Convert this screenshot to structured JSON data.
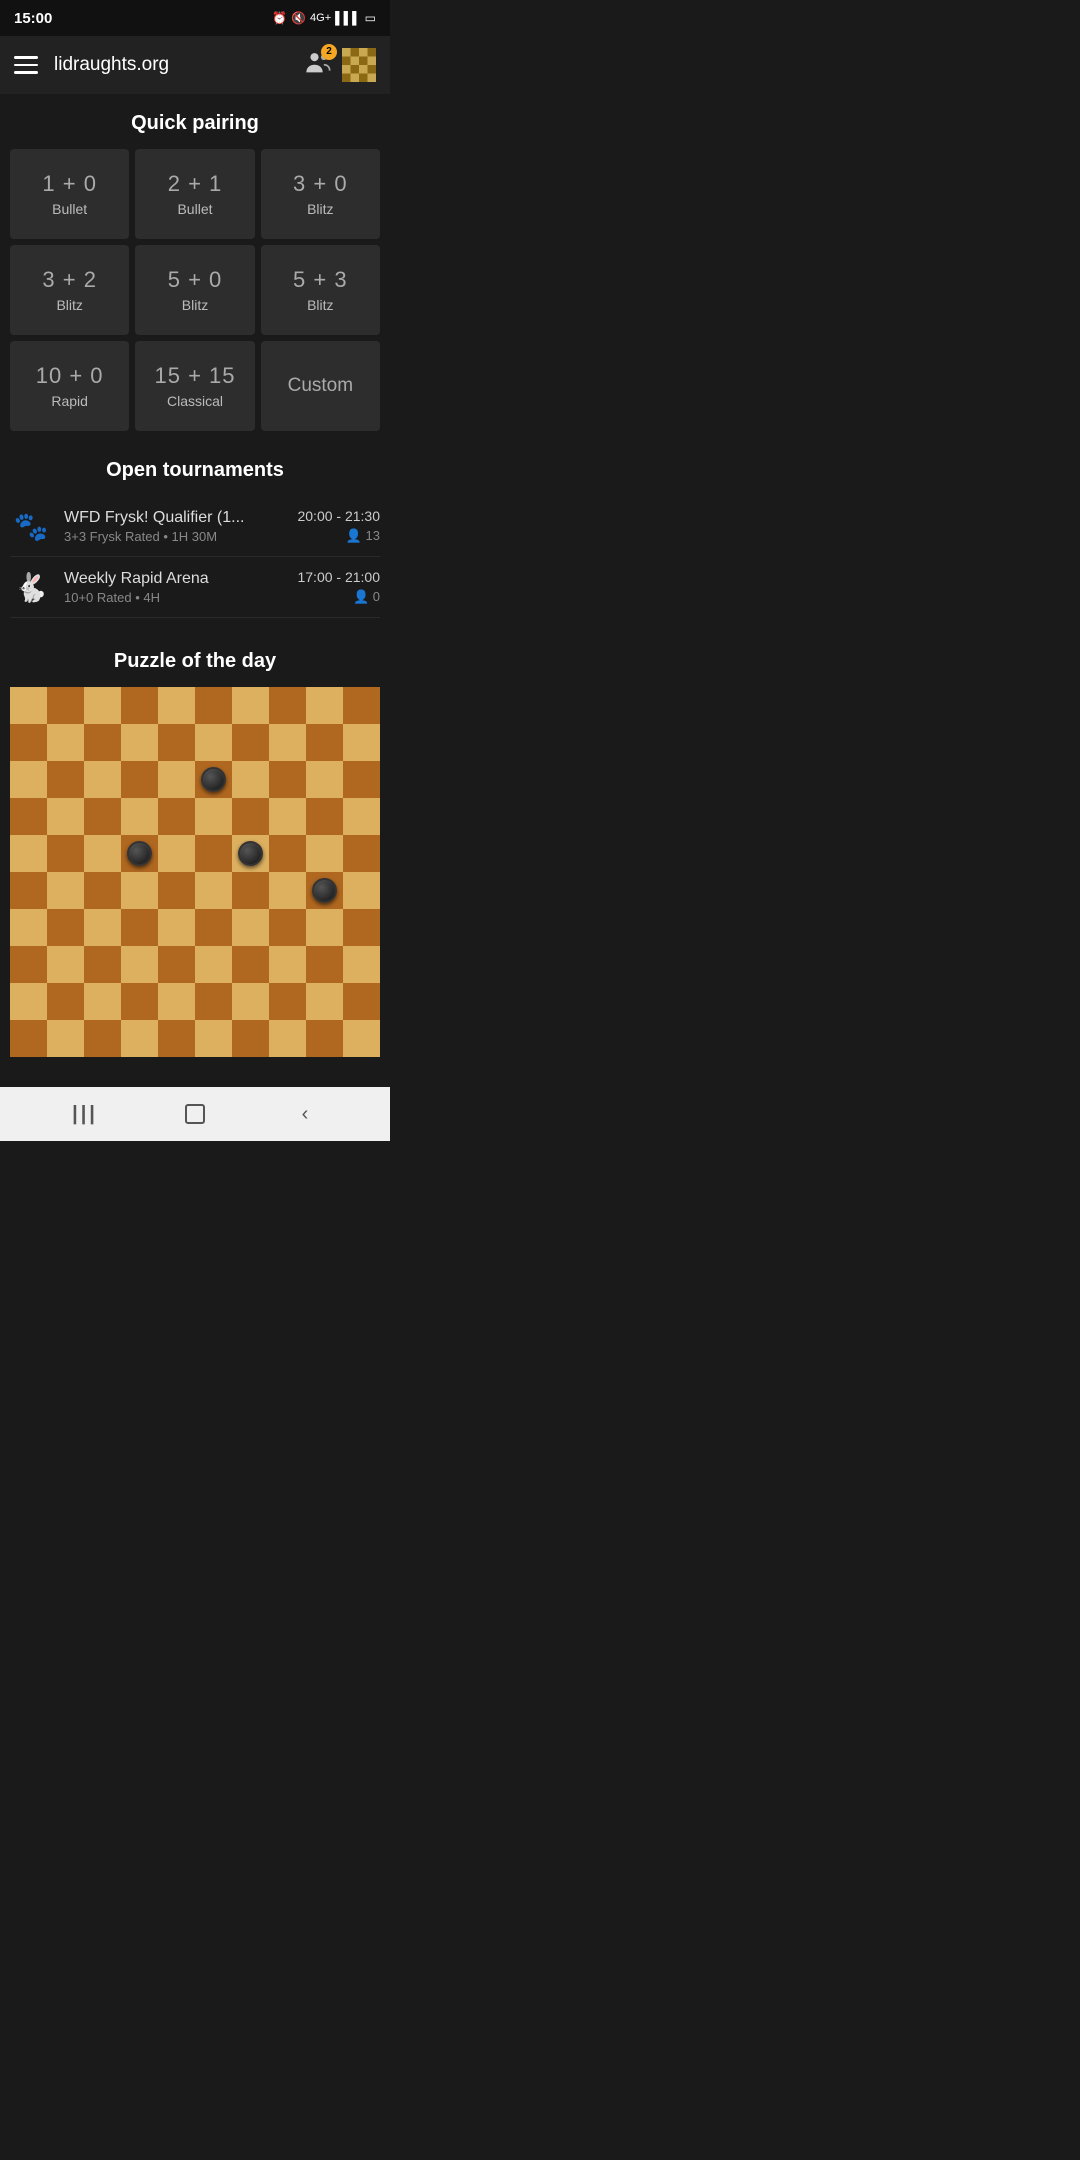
{
  "statusBar": {
    "time": "15:00",
    "icons": "⏰ 🔇 4G+ ▐▌▌ 🔋"
  },
  "header": {
    "title": "lidraughts.org",
    "notificationCount": "2"
  },
  "quickPairing": {
    "sectionTitle": "Quick pairing",
    "cards": [
      {
        "time": "1 + 0",
        "label": "Bullet"
      },
      {
        "time": "2 + 1",
        "label": "Bullet"
      },
      {
        "time": "3 + 0",
        "label": "Blitz"
      },
      {
        "time": "3 + 2",
        "label": "Blitz"
      },
      {
        "time": "5 + 0",
        "label": "Blitz"
      },
      {
        "time": "5 + 3",
        "label": "Blitz"
      },
      {
        "time": "10 + 0",
        "label": "Rapid"
      },
      {
        "time": "15 + 15",
        "label": "Classical"
      },
      {
        "time": "Custom",
        "label": ""
      }
    ]
  },
  "openTournaments": {
    "sectionTitle": "Open tournaments",
    "items": [
      {
        "icon": "🐾",
        "name": "WFD Frysk! Qualifier (1...",
        "details": "3+3 Frysk Rated • 1H 30M",
        "timeRange": "20:00 - 21:30",
        "players": "13"
      },
      {
        "icon": "🐇",
        "name": "Weekly Rapid Arena",
        "details": "10+0 Rated • 4H",
        "timeRange": "17:00 - 21:00",
        "players": "0"
      }
    ]
  },
  "puzzle": {
    "sectionTitle": "Puzzle of the day"
  },
  "bottomNav": {
    "back": "❮",
    "home": "⬜",
    "menu": "|||"
  },
  "board": {
    "size": 10,
    "pieces": [
      {
        "row": 2,
        "col": 5,
        "color": "dark"
      },
      {
        "row": 4,
        "col": 3,
        "color": "dark"
      },
      {
        "row": 4,
        "col": 6,
        "color": "dark"
      },
      {
        "row": 5,
        "col": 8,
        "color": "dark"
      }
    ]
  }
}
